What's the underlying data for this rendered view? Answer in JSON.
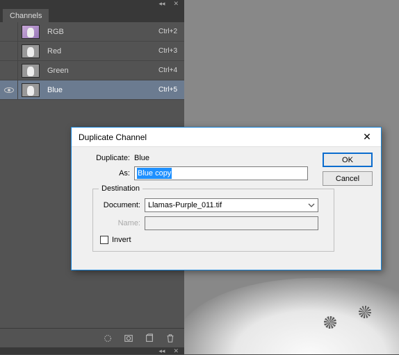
{
  "panel": {
    "tab": "Channels",
    "channels": [
      {
        "name": "RGB",
        "shortcut": "Ctrl+2",
        "visible": false,
        "selected": false,
        "thumb": "rgb"
      },
      {
        "name": "Red",
        "shortcut": "Ctrl+3",
        "visible": false,
        "selected": false,
        "thumb": "mono"
      },
      {
        "name": "Green",
        "shortcut": "Ctrl+4",
        "visible": false,
        "selected": false,
        "thumb": "mono"
      },
      {
        "name": "Blue",
        "shortcut": "Ctrl+5",
        "visible": true,
        "selected": true,
        "thumb": "mono"
      }
    ],
    "footer_icons": [
      "selection-to-channel",
      "mask-from-channel",
      "new-channel",
      "delete-channel"
    ]
  },
  "dialog": {
    "title": "Duplicate Channel",
    "duplicate_label": "Duplicate:",
    "duplicate_value": "Blue",
    "as_label": "As:",
    "as_value": "Blue copy",
    "destination_legend": "Destination",
    "document_label": "Document:",
    "document_value": "Llamas-Purple_011.tif",
    "name_label": "Name:",
    "name_value": "",
    "invert_label": "Invert",
    "invert_checked": false,
    "ok": "OK",
    "cancel": "Cancel",
    "close_glyph": "✕"
  },
  "window_controls": {
    "collapse": "◂◂",
    "close": "✕"
  }
}
